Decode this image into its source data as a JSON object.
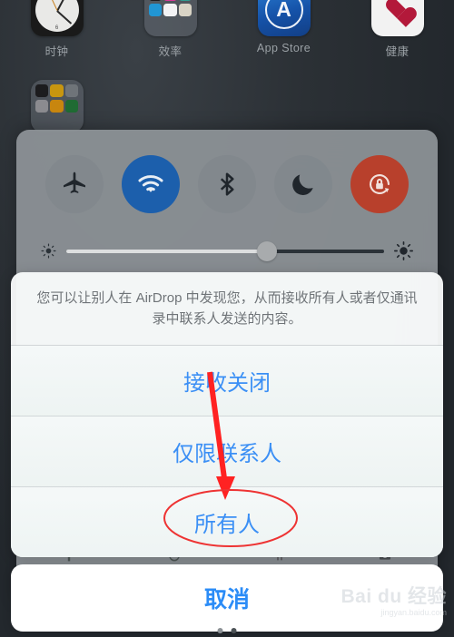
{
  "homescreen": {
    "apps_row1": [
      {
        "label": "时钟",
        "icon": "clock-icon"
      },
      {
        "label": "效率",
        "icon": "folder-icon"
      },
      {
        "label": "App Store",
        "icon": "app-store-icon"
      },
      {
        "label": "健康",
        "icon": "health-icon"
      }
    ],
    "apps_row2": [
      {
        "label": "",
        "icon": "folder-icon"
      }
    ]
  },
  "control_center": {
    "toggles": [
      {
        "name": "airplane-mode",
        "icon": "airplane-icon",
        "state": "off"
      },
      {
        "name": "wifi",
        "icon": "wifi-icon",
        "state": "on"
      },
      {
        "name": "bluetooth",
        "icon": "bluetooth-icon",
        "state": "off"
      },
      {
        "name": "do-not-disturb",
        "icon": "moon-icon",
        "state": "off"
      },
      {
        "name": "rotation-lock",
        "icon": "rotation-lock-icon",
        "state": "on"
      }
    ],
    "brightness": {
      "value_percent": 63,
      "low_icon": "brightness-low-icon",
      "high_icon": "brightness-high-icon"
    },
    "shortcuts": [
      {
        "name": "flashlight",
        "icon": "flashlight-icon"
      },
      {
        "name": "timer",
        "icon": "timer-icon"
      },
      {
        "name": "calculator",
        "icon": "calculator-icon"
      },
      {
        "name": "camera",
        "icon": "camera-icon"
      }
    ]
  },
  "action_sheet": {
    "message": "您可以让别人在 AirDrop 中发现您，从而接收所有人或者仅通讯录中联系人发送的内容。",
    "options": [
      {
        "label": "接收关闭",
        "name": "receiving-off"
      },
      {
        "label": "仅限联系人",
        "name": "contacts-only"
      },
      {
        "label": "所有人",
        "name": "everyone",
        "highlighted": true
      }
    ],
    "cancel_label": "取消"
  },
  "annotations": {
    "arrow_color": "#ff2222",
    "ellipse_color": "#ee3333",
    "arrow_target": "所有人"
  },
  "watermark": {
    "main": "Bai du 经验",
    "sub": "jingyan.baidu.com"
  },
  "colors": {
    "ios_blue": "#3b8ff5",
    "wifi_on": "#1c5fac",
    "rotation_lock_on": "#b8402c",
    "toggle_off": "#80868c",
    "panel": "#8e9398"
  }
}
